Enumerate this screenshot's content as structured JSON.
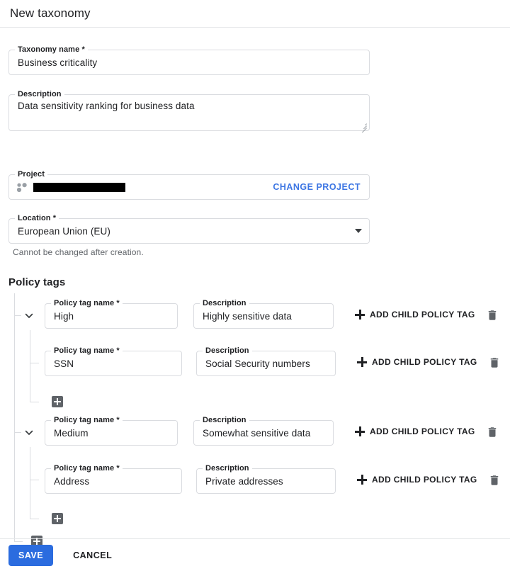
{
  "dialog": {
    "title": "New taxonomy"
  },
  "form": {
    "taxonomy_name": {
      "label": "Taxonomy name *",
      "value": "Business criticality"
    },
    "description": {
      "label": "Description",
      "value": "Data sensitivity ranking for business data"
    },
    "project": {
      "label": "Project",
      "value": "",
      "redacted": true,
      "change_label": "CHANGE PROJECT",
      "icon": "project-dots-icon"
    },
    "location": {
      "label": "Location *",
      "value": "European Union (EU)",
      "hint": "Cannot be changed after creation.",
      "icon": "chevron-down-icon"
    }
  },
  "policy_tags": {
    "section_title": "Policy tags",
    "name_label": "Policy tag name *",
    "desc_label": "Description",
    "add_child_label": "ADD CHILD POLICY TAG",
    "add_child_icon": "plus-icon",
    "delete_icon": "trash-icon",
    "expand_icon": "chevron-down-icon",
    "add_sibling_icon": "plus-square-icon",
    "nodes": [
      {
        "name": "High",
        "description": "Highly sensitive data",
        "children": [
          {
            "name": "SSN",
            "description": "Social Security numbers"
          }
        ]
      },
      {
        "name": "Medium",
        "description": "Somewhat sensitive data",
        "children": [
          {
            "name": "Address",
            "description": "Private addresses"
          }
        ]
      }
    ]
  },
  "footer": {
    "save_label": "SAVE",
    "cancel_label": "CANCEL"
  },
  "colors": {
    "accent_blue": "#2b6cdf",
    "link_blue": "#3d76e3",
    "border": "#dadce0",
    "text": "#202124",
    "muted_text": "#5f6368",
    "add_square": "#5f6368"
  }
}
